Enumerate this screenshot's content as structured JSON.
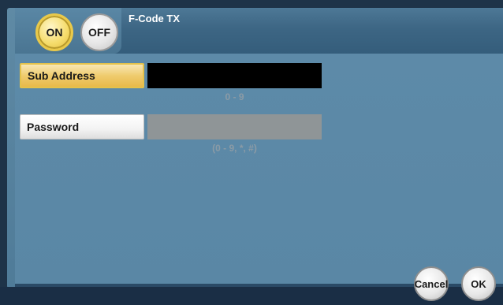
{
  "header": {
    "title": "F-Code TX",
    "toggle_on_label": "ON",
    "toggle_off_label": "OFF",
    "selected": "ON"
  },
  "fields": {
    "sub_address": {
      "label": "Sub Address",
      "value": "",
      "hint": "0 - 9"
    },
    "password": {
      "label": "Password",
      "value": "",
      "hint": "(0 - 9, *, #)"
    }
  },
  "footer": {
    "cancel_label": "Cancel",
    "ok_label": "OK"
  },
  "colors": {
    "background": "#5a87a5",
    "header": "#3d6684",
    "selected_accent": "#efcc6e",
    "active_input": "#000000",
    "inactive_input": "#8f9597",
    "hint_text": "#8b9ba6"
  }
}
